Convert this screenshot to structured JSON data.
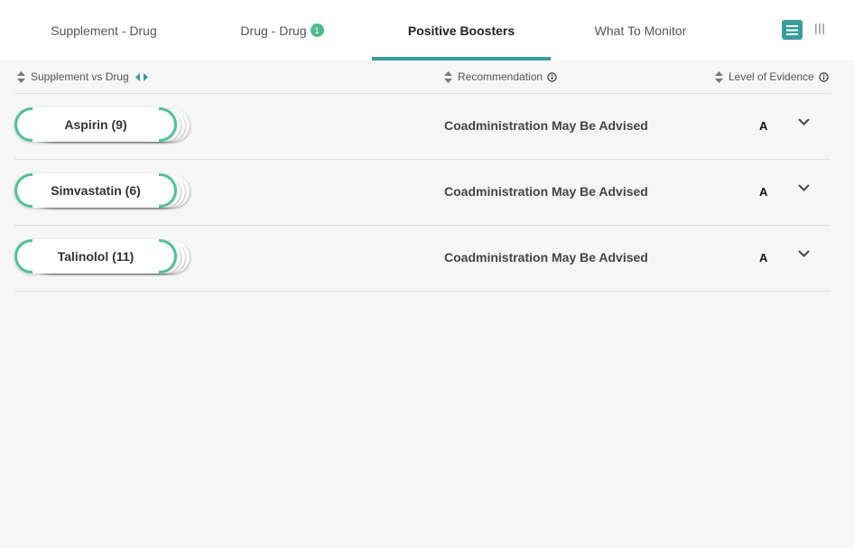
{
  "tabs": [
    {
      "label": "Supplement - Drug",
      "badge": null,
      "active": false
    },
    {
      "label": "Drug - Drug",
      "badge": "1",
      "active": false
    },
    {
      "label": "Positive Boosters",
      "badge": null,
      "active": true
    },
    {
      "label": "What To Monitor",
      "badge": null,
      "active": false
    }
  ],
  "view_toggle": {
    "selected": "list"
  },
  "columns": {
    "supplement_vs_drug": "Supplement vs Drug",
    "recommendation": "Recommendation",
    "level_of_evidence": "Level of Evidence"
  },
  "rows": [
    {
      "drug": "Aspirin (9)",
      "recommendation": "Coadministration May Be Advised",
      "level": "A"
    },
    {
      "drug": "Simvastatin (6)",
      "recommendation": "Coadministration May Be Advised",
      "level": "A"
    },
    {
      "drug": "Talinolol (11)",
      "recommendation": "Coadministration May Be Advised",
      "level": "A"
    }
  ],
  "colors": {
    "accent": "#3a9c9b",
    "green": "#4fc196",
    "badge": "#52b98b"
  }
}
